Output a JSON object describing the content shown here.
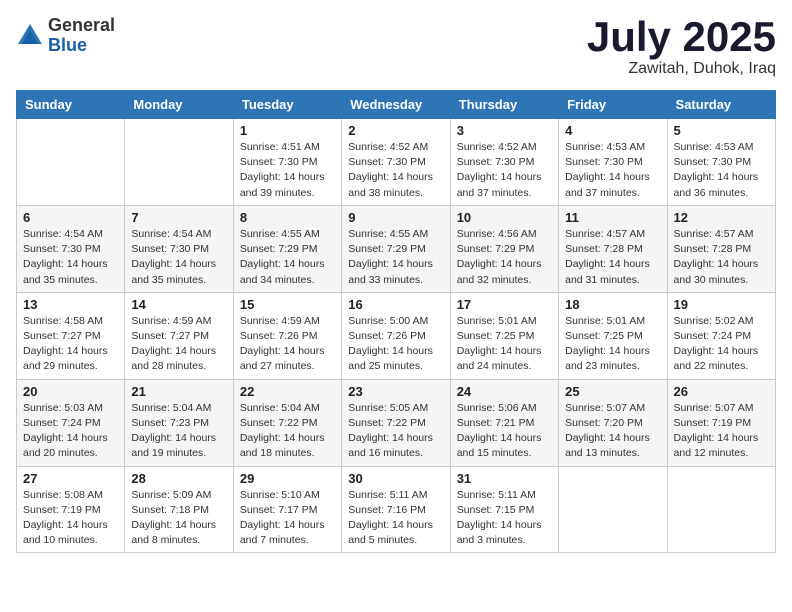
{
  "logo": {
    "general": "General",
    "blue": "Blue"
  },
  "header": {
    "month": "July 2025",
    "location": "Zawitah, Duhok, Iraq"
  },
  "days_of_week": [
    "Sunday",
    "Monday",
    "Tuesday",
    "Wednesday",
    "Thursday",
    "Friday",
    "Saturday"
  ],
  "weeks": [
    [
      {
        "day": "",
        "info": ""
      },
      {
        "day": "",
        "info": ""
      },
      {
        "day": "1",
        "info": "Sunrise: 4:51 AM\nSunset: 7:30 PM\nDaylight: 14 hours\nand 39 minutes."
      },
      {
        "day": "2",
        "info": "Sunrise: 4:52 AM\nSunset: 7:30 PM\nDaylight: 14 hours\nand 38 minutes."
      },
      {
        "day": "3",
        "info": "Sunrise: 4:52 AM\nSunset: 7:30 PM\nDaylight: 14 hours\nand 37 minutes."
      },
      {
        "day": "4",
        "info": "Sunrise: 4:53 AM\nSunset: 7:30 PM\nDaylight: 14 hours\nand 37 minutes."
      },
      {
        "day": "5",
        "info": "Sunrise: 4:53 AM\nSunset: 7:30 PM\nDaylight: 14 hours\nand 36 minutes."
      }
    ],
    [
      {
        "day": "6",
        "info": "Sunrise: 4:54 AM\nSunset: 7:30 PM\nDaylight: 14 hours\nand 35 minutes."
      },
      {
        "day": "7",
        "info": "Sunrise: 4:54 AM\nSunset: 7:30 PM\nDaylight: 14 hours\nand 35 minutes."
      },
      {
        "day": "8",
        "info": "Sunrise: 4:55 AM\nSunset: 7:29 PM\nDaylight: 14 hours\nand 34 minutes."
      },
      {
        "day": "9",
        "info": "Sunrise: 4:55 AM\nSunset: 7:29 PM\nDaylight: 14 hours\nand 33 minutes."
      },
      {
        "day": "10",
        "info": "Sunrise: 4:56 AM\nSunset: 7:29 PM\nDaylight: 14 hours\nand 32 minutes."
      },
      {
        "day": "11",
        "info": "Sunrise: 4:57 AM\nSunset: 7:28 PM\nDaylight: 14 hours\nand 31 minutes."
      },
      {
        "day": "12",
        "info": "Sunrise: 4:57 AM\nSunset: 7:28 PM\nDaylight: 14 hours\nand 30 minutes."
      }
    ],
    [
      {
        "day": "13",
        "info": "Sunrise: 4:58 AM\nSunset: 7:27 PM\nDaylight: 14 hours\nand 29 minutes."
      },
      {
        "day": "14",
        "info": "Sunrise: 4:59 AM\nSunset: 7:27 PM\nDaylight: 14 hours\nand 28 minutes."
      },
      {
        "day": "15",
        "info": "Sunrise: 4:59 AM\nSunset: 7:26 PM\nDaylight: 14 hours\nand 27 minutes."
      },
      {
        "day": "16",
        "info": "Sunrise: 5:00 AM\nSunset: 7:26 PM\nDaylight: 14 hours\nand 25 minutes."
      },
      {
        "day": "17",
        "info": "Sunrise: 5:01 AM\nSunset: 7:25 PM\nDaylight: 14 hours\nand 24 minutes."
      },
      {
        "day": "18",
        "info": "Sunrise: 5:01 AM\nSunset: 7:25 PM\nDaylight: 14 hours\nand 23 minutes."
      },
      {
        "day": "19",
        "info": "Sunrise: 5:02 AM\nSunset: 7:24 PM\nDaylight: 14 hours\nand 22 minutes."
      }
    ],
    [
      {
        "day": "20",
        "info": "Sunrise: 5:03 AM\nSunset: 7:24 PM\nDaylight: 14 hours\nand 20 minutes."
      },
      {
        "day": "21",
        "info": "Sunrise: 5:04 AM\nSunset: 7:23 PM\nDaylight: 14 hours\nand 19 minutes."
      },
      {
        "day": "22",
        "info": "Sunrise: 5:04 AM\nSunset: 7:22 PM\nDaylight: 14 hours\nand 18 minutes."
      },
      {
        "day": "23",
        "info": "Sunrise: 5:05 AM\nSunset: 7:22 PM\nDaylight: 14 hours\nand 16 minutes."
      },
      {
        "day": "24",
        "info": "Sunrise: 5:06 AM\nSunset: 7:21 PM\nDaylight: 14 hours\nand 15 minutes."
      },
      {
        "day": "25",
        "info": "Sunrise: 5:07 AM\nSunset: 7:20 PM\nDaylight: 14 hours\nand 13 minutes."
      },
      {
        "day": "26",
        "info": "Sunrise: 5:07 AM\nSunset: 7:19 PM\nDaylight: 14 hours\nand 12 minutes."
      }
    ],
    [
      {
        "day": "27",
        "info": "Sunrise: 5:08 AM\nSunset: 7:19 PM\nDaylight: 14 hours\nand 10 minutes."
      },
      {
        "day": "28",
        "info": "Sunrise: 5:09 AM\nSunset: 7:18 PM\nDaylight: 14 hours\nand 8 minutes."
      },
      {
        "day": "29",
        "info": "Sunrise: 5:10 AM\nSunset: 7:17 PM\nDaylight: 14 hours\nand 7 minutes."
      },
      {
        "day": "30",
        "info": "Sunrise: 5:11 AM\nSunset: 7:16 PM\nDaylight: 14 hours\nand 5 minutes."
      },
      {
        "day": "31",
        "info": "Sunrise: 5:11 AM\nSunset: 7:15 PM\nDaylight: 14 hours\nand 3 minutes."
      },
      {
        "day": "",
        "info": ""
      },
      {
        "day": "",
        "info": ""
      }
    ]
  ]
}
